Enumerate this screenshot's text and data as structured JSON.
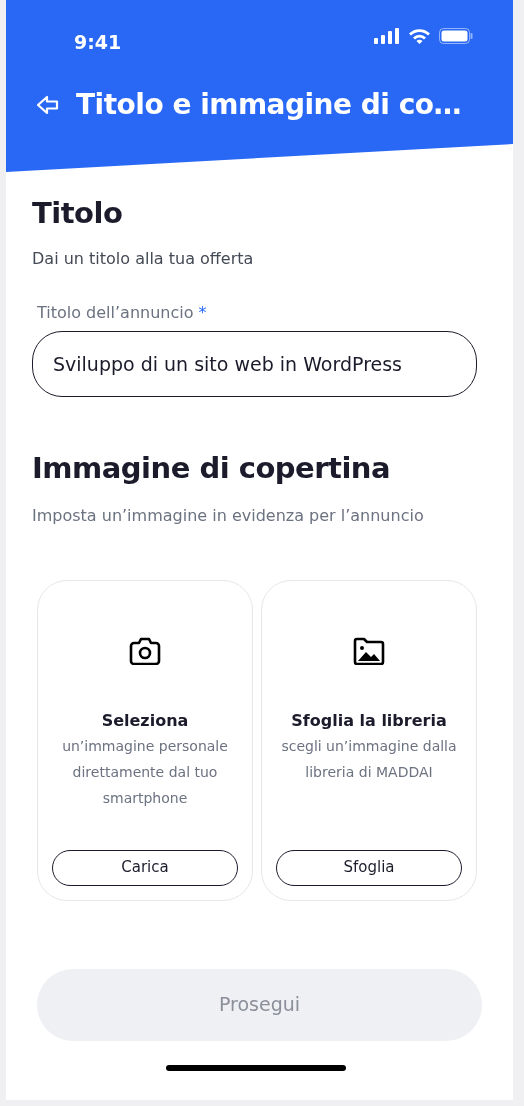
{
  "status_bar": {
    "time": "9:41"
  },
  "header": {
    "title": "Titolo e immagine di co…"
  },
  "title_section": {
    "heading": "Titolo",
    "subtitle": "Dai un titolo alla tua offerta",
    "field": {
      "label": "Titolo dell’annuncio",
      "required_mark": "*",
      "value": "Sviluppo di un sito web in WordPress"
    }
  },
  "cover_section": {
    "heading": "Immagine di copertina",
    "subtitle": "Imposta un’immagine in evidenza per l’annuncio",
    "options": [
      {
        "kind": "camera",
        "title": "Seleziona",
        "description": "un’immagine personale direttamente dal tuo smartphone",
        "button": "Carica"
      },
      {
        "kind": "library",
        "title": "Sfoglia la libreria",
        "description": "scegli un’immagine dalla libreria di MADDAI",
        "button": "Sfoglia"
      }
    ]
  },
  "footer": {
    "button": "Prosegui",
    "disabled": true
  }
}
